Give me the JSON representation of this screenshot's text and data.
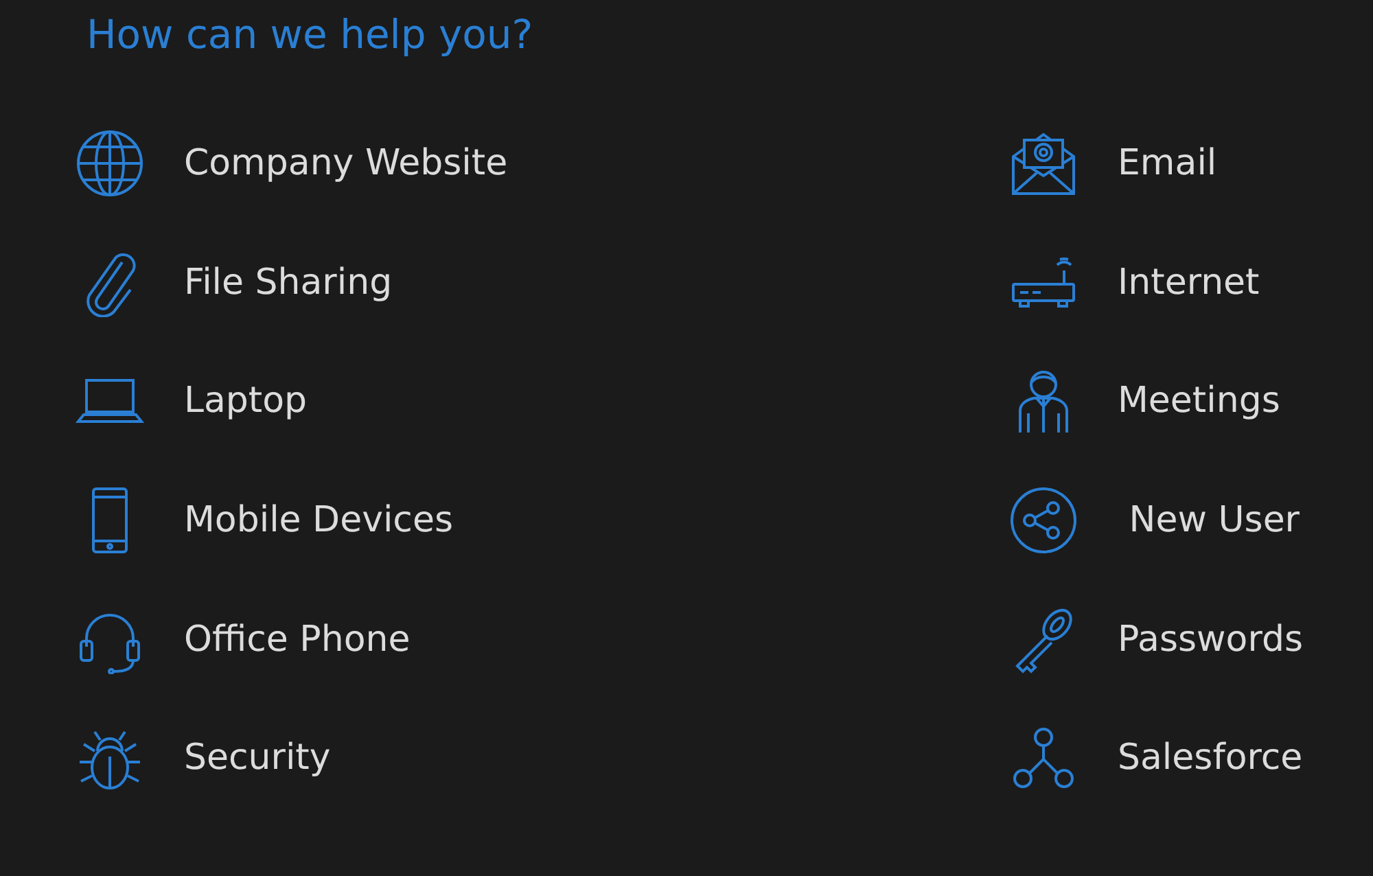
{
  "title": "How can we help you?",
  "items": [
    {
      "label": "Company Website"
    },
    {
      "label": "Email"
    },
    {
      "label": "File Sharing"
    },
    {
      "label": "Internet"
    },
    {
      "label": "Laptop"
    },
    {
      "label": "Meetings"
    },
    {
      "label": "Mobile Devices"
    },
    {
      "label": " New User"
    },
    {
      "label": "Office Phone"
    },
    {
      "label": "Passwords"
    },
    {
      "label": "Security"
    },
    {
      "label": "Salesforce"
    }
  ]
}
